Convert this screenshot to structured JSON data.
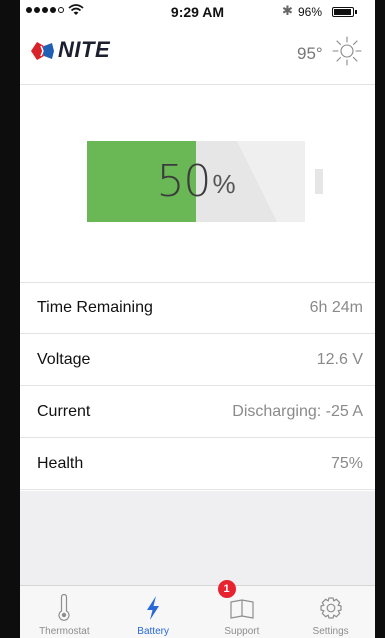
{
  "status_bar": {
    "time": "9:29 AM",
    "battery_percent": "96%",
    "battery_level": 0.96
  },
  "header": {
    "brand": "NITE",
    "temperature": "95°",
    "weather_icon": "sun-icon"
  },
  "battery": {
    "value": "50",
    "unit": "%",
    "level": 0.5,
    "fill_color": "#6ab855"
  },
  "info": {
    "rows": [
      {
        "label": "Time Remaining",
        "value": "6h 24m"
      },
      {
        "label": "Voltage",
        "value": "12.6 V"
      },
      {
        "label": "Current",
        "value": "Discharging: -25 A"
      },
      {
        "label": "Health",
        "value": "75%"
      }
    ]
  },
  "tabs": [
    {
      "label": "Thermostat",
      "icon": "thermometer-icon"
    },
    {
      "label": "Battery",
      "icon": "lightning-icon",
      "active": true
    },
    {
      "label": "Support",
      "icon": "book-icon",
      "badge": "1"
    },
    {
      "label": "Settings",
      "icon": "gear-icon"
    }
  ],
  "colors": {
    "accent": "#2a6ad6",
    "badge": "#e6232e",
    "battery_green": "#6ab855"
  }
}
